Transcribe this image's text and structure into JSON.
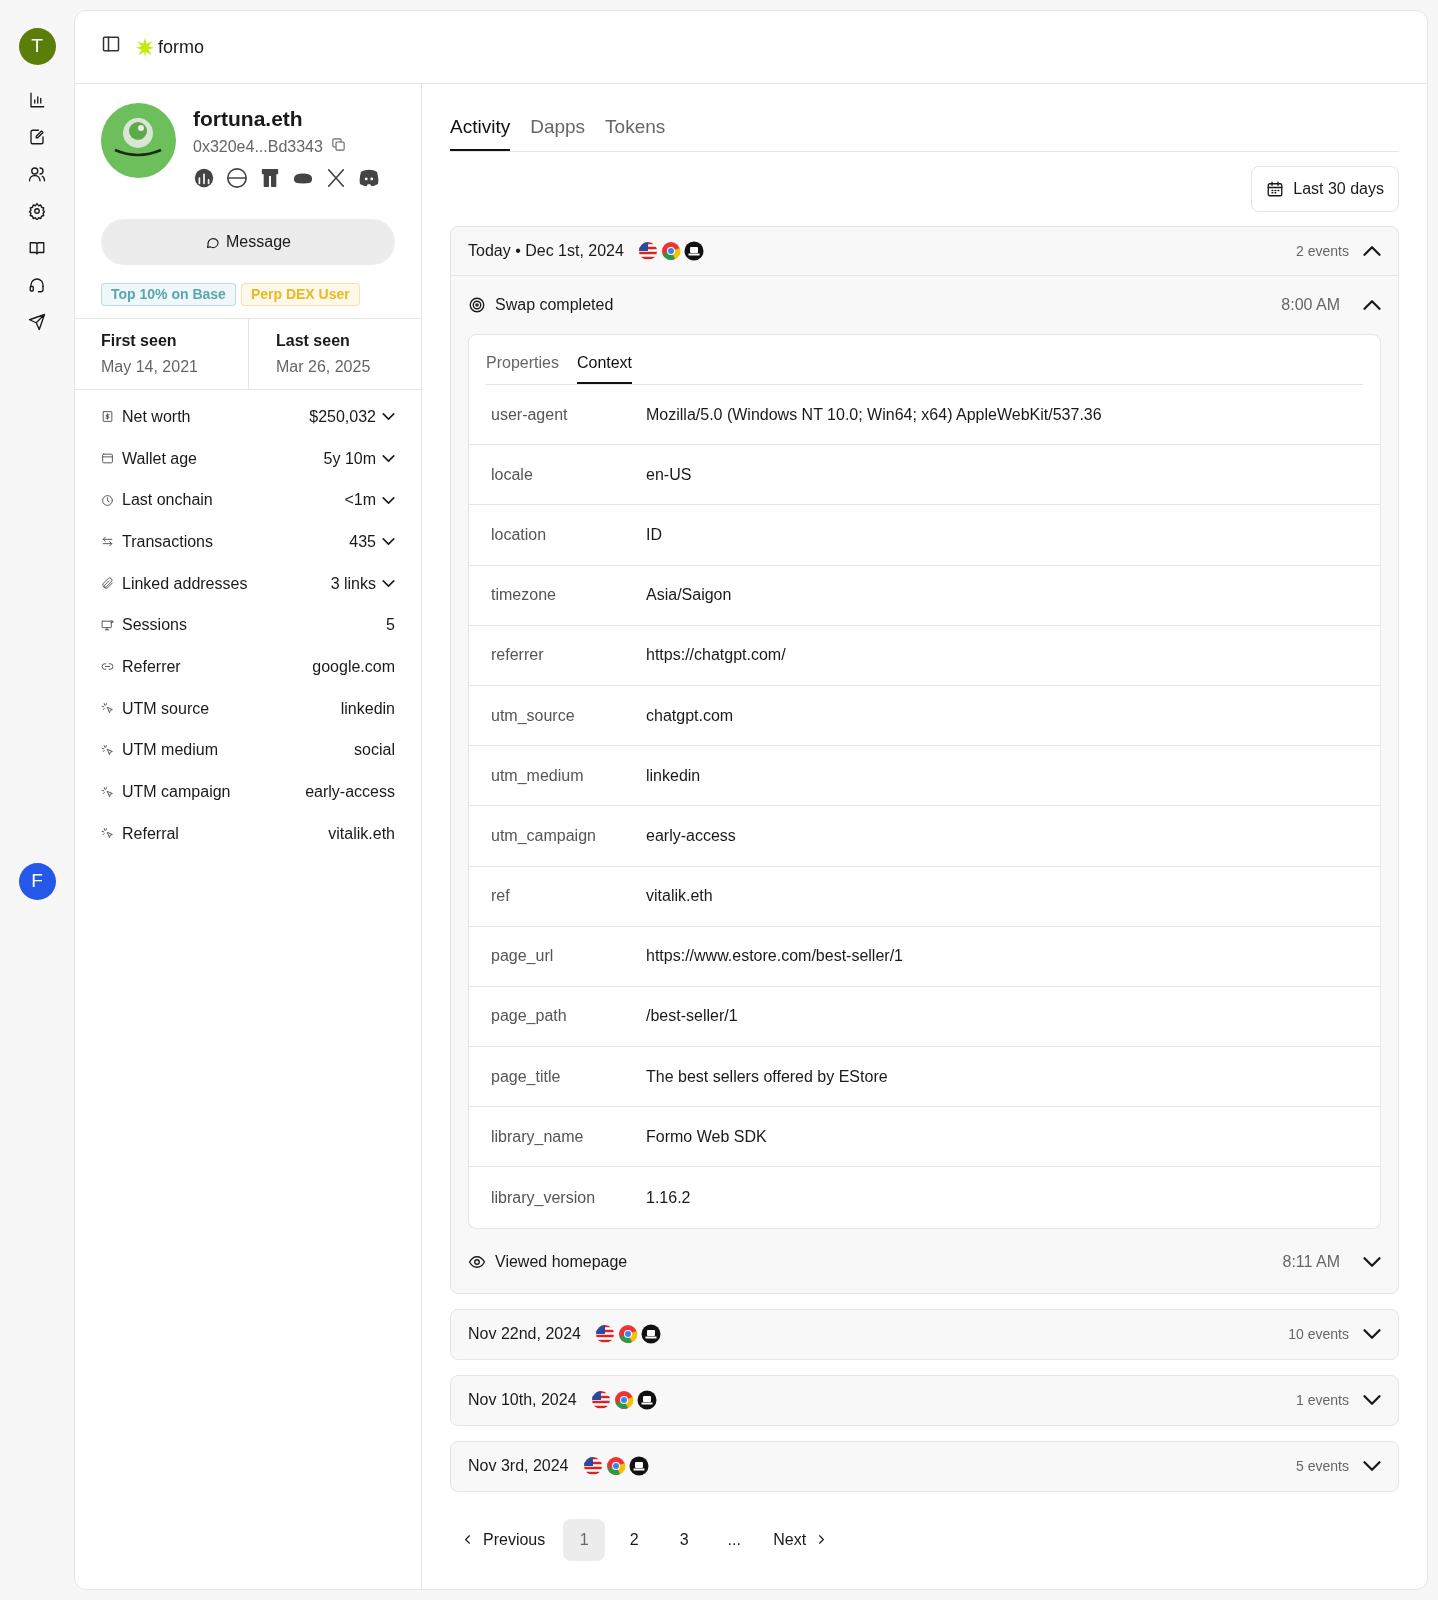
{
  "rail": {
    "user_initial": "T",
    "nav": [
      {
        "kind": "chart",
        "selected": false
      },
      {
        "kind": "edit",
        "selected": false
      },
      {
        "kind": "users",
        "selected": false
      },
      {
        "kind": "settings",
        "selected": false
      },
      {
        "kind": "book",
        "selected": false
      },
      {
        "kind": "support",
        "selected": false
      },
      {
        "kind": "send",
        "selected": false
      }
    ],
    "bottom_initial": "F"
  },
  "header": {
    "brand": "formo"
  },
  "profile": {
    "name": "fortuna.eth",
    "address": "0x320e4...Bd3343",
    "message_button": "Message",
    "badges": [
      {
        "label": "Top 10% on Base",
        "color": "#5aa6b0"
      },
      {
        "label": "Perp DEX User",
        "color": "#e8b920"
      }
    ],
    "first_seen": {
      "label": "First seen",
      "value": "May 14, 2021"
    },
    "last_seen": {
      "label": "Last seen",
      "value": "Mar 26, 2025"
    },
    "stats": [
      {
        "label": "Net worth",
        "value": "$250,032",
        "expandable": true
      },
      {
        "label": "Wallet age",
        "value": "5y 10m",
        "expandable": true
      },
      {
        "label": "Last onchain",
        "value": "<1m",
        "expandable": true
      },
      {
        "label": "Transactions",
        "value": "435",
        "expandable": true
      },
      {
        "label": "Linked addresses",
        "value": "3 links",
        "expandable": true
      },
      {
        "label": "Sessions",
        "value": "5",
        "expandable": false
      },
      {
        "label": "Referrer",
        "value": "google.com",
        "expandable": false
      },
      {
        "label": "UTM source",
        "value": "linkedin",
        "expandable": false
      },
      {
        "label": "UTM medium",
        "value": "social",
        "expandable": false
      },
      {
        "label": "UTM campaign",
        "value": "early-access",
        "expandable": false
      },
      {
        "label": "Referral",
        "value": "vitalik.eth",
        "expandable": false
      }
    ]
  },
  "tabs": [
    {
      "label": "Activity",
      "selected": true
    },
    {
      "label": "Dapps",
      "selected": false
    },
    {
      "label": "Tokens",
      "selected": false
    }
  ],
  "date_filter": "Last 30 days",
  "groups": [
    {
      "date": "Today • Dec 1st, 2024",
      "count": "2 events",
      "expanded": true,
      "events": [
        {
          "kind": "swap",
          "name": "Swap completed",
          "time": "8:00 AM",
          "expanded": true,
          "detail_tabs": [
            {
              "label": "Properties",
              "selected": false
            },
            {
              "label": "Context",
              "selected": true
            }
          ],
          "context": [
            [
              "user-agent",
              "Mozilla/5.0 (Windows NT 10.0; Win64; x64) AppleWebKit/537.36"
            ],
            [
              "locale",
              "en-US"
            ],
            [
              "location",
              "ID"
            ],
            [
              "timezone",
              "Asia/Saigon"
            ],
            [
              "referrer",
              "https://chatgpt.com/"
            ],
            [
              "utm_source",
              "chatgpt.com"
            ],
            [
              "utm_medium",
              "linkedin"
            ],
            [
              "utm_campaign",
              "early-access"
            ],
            [
              "ref",
              "vitalik.eth"
            ],
            [
              "page_url",
              "https://www.estore.com/best-seller/1"
            ],
            [
              "page_path",
              "/best-seller/1"
            ],
            [
              "page_title",
              "The best sellers offered by EStore"
            ],
            [
              "library_name",
              "Formo Web SDK"
            ],
            [
              "library_version",
              "1.16.2"
            ]
          ]
        },
        {
          "kind": "view",
          "name": "Viewed homepage",
          "time": "8:11 AM",
          "expanded": false
        }
      ]
    },
    {
      "date": "Nov 22nd, 2024",
      "count": "10 events",
      "expanded": false
    },
    {
      "date": "Nov 10th, 2024",
      "count": "1 events",
      "expanded": false
    },
    {
      "date": "Nov 3rd, 2024",
      "count": "5 events",
      "expanded": false
    }
  ],
  "pagination": {
    "previous": "Previous",
    "pages": [
      {
        "label": "1",
        "selected": true
      },
      {
        "label": "2",
        "selected": false
      },
      {
        "label": "3",
        "selected": false
      }
    ],
    "ellipsis": "...",
    "next": "Next"
  }
}
